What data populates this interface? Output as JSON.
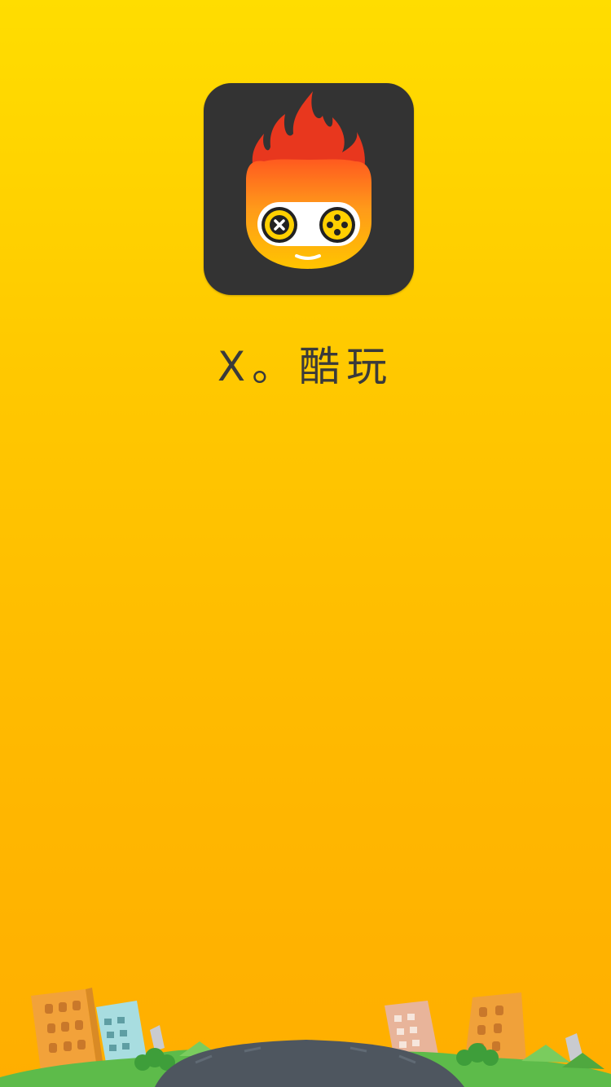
{
  "splash": {
    "app_name": "X。酷玩",
    "icon_name": "flame-head-gamepad-icon",
    "background_colors": [
      "#FFDD00",
      "#FFAE00"
    ],
    "icon_background": "#333333",
    "scene_name": "city-skyline-illustration"
  }
}
